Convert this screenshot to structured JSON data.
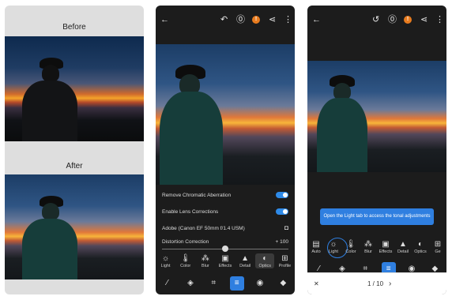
{
  "panel1": {
    "before_label": "Before",
    "after_label": "After"
  },
  "panel2": {
    "icons": {
      "back": "back-arrow-icon",
      "undo": "undo-icon",
      "help": "help-icon",
      "warning": "warning-icon",
      "share": "share-icon",
      "more": "more-icon"
    },
    "warning_text": "!",
    "rows": {
      "chromatic": "Remove Chromatic Aberration",
      "lens": "Enable Lens Corrections",
      "lens_profile": "Adobe (Canon EF 50mm f/1.4 USM)",
      "distortion": "Distortion Correction",
      "distortion_value": "+ 100"
    },
    "tools": [
      "Light",
      "Color",
      "Blur",
      "Effects",
      "Detail",
      "Optics",
      "Profile"
    ]
  },
  "panel3": {
    "tip": "Open the Light tab to access the tonal adjustments",
    "tools": [
      "Auto",
      "Light",
      "Color",
      "Blur",
      "Effects",
      "Detail",
      "Optics",
      "Ge"
    ],
    "pager": "1 / 10",
    "close": "✕",
    "next": "›"
  },
  "colors": {
    "accent": "#2f7fe0",
    "warning": "#e87b1e",
    "dark_bg": "#1c1c1c"
  }
}
